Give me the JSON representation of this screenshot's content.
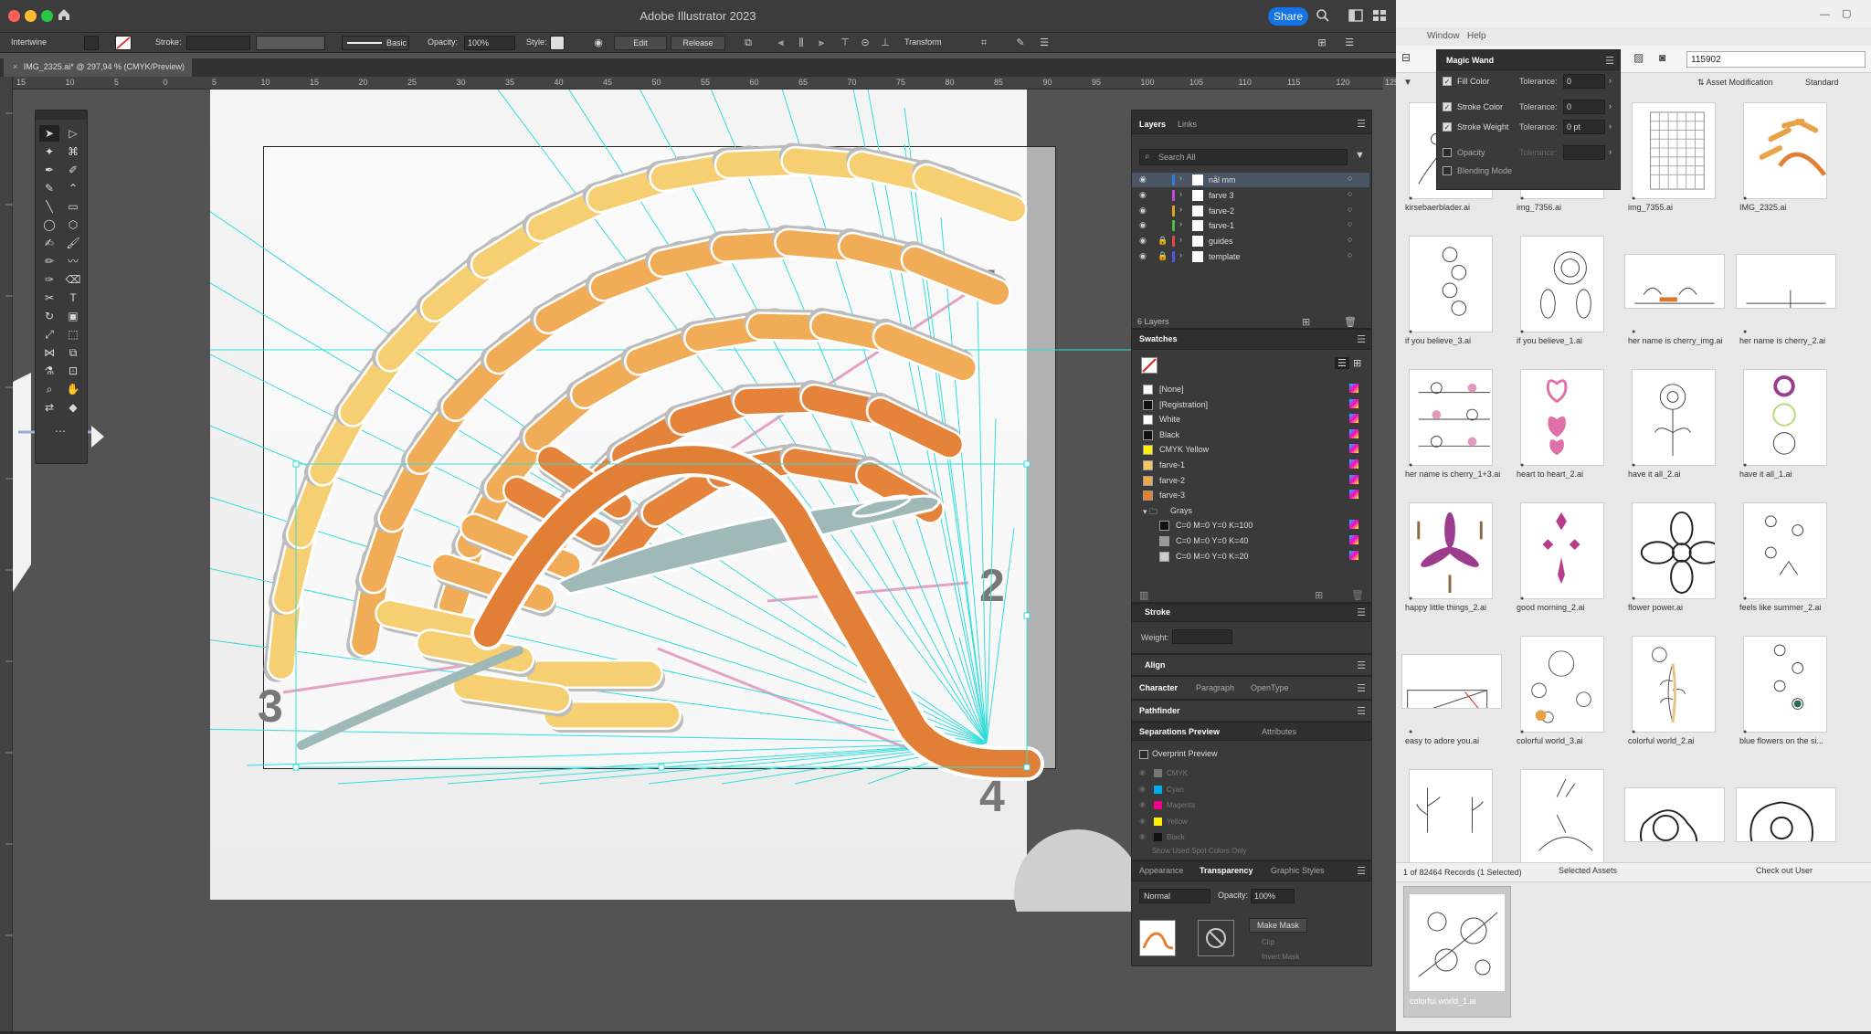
{
  "app": {
    "title": "Adobe Illustrator 2023",
    "share_label": "Share",
    "traffic_colors": [
      "#ff5f57",
      "#febc2e",
      "#28c840"
    ]
  },
  "control": {
    "object_type": "Intertwine",
    "stroke_label": "Stroke:",
    "brush_label": "Basic",
    "opacity_label": "Opacity:",
    "opacity_value": "100%",
    "style_label": "Style:",
    "edit_label": "Edit",
    "release_label": "Release",
    "transform_label": "Transform"
  },
  "document": {
    "tab_label": "IMG_2325.ai* @ 297,94 % (CMYK/Preview)",
    "ruler_ticks": [
      "15",
      "10",
      "5",
      "0",
      "5",
      "10",
      "15",
      "20",
      "25",
      "30",
      "35",
      "40",
      "45",
      "50",
      "55",
      "60",
      "65",
      "70",
      "75",
      "80",
      "85",
      "90",
      "95",
      "100",
      "105",
      "110",
      "115",
      "120",
      "125"
    ]
  },
  "artwork": {
    "numbers": [
      "1",
      "2",
      "3",
      "4"
    ]
  },
  "layers_panel": {
    "tabs": [
      "Layers",
      "Links"
    ],
    "search_placeholder": "Search All",
    "layers": [
      {
        "name": "nål mm",
        "color": "#2f7fd8",
        "locked": false
      },
      {
        "name": "farve 3",
        "color": "#c04bd8",
        "locked": false
      },
      {
        "name": "farve-2",
        "color": "#e0a020",
        "locked": false
      },
      {
        "name": "farve-1",
        "color": "#42c24a",
        "locked": false
      },
      {
        "name": "guides",
        "color": "#e04848",
        "locked": true
      },
      {
        "name": "template",
        "color": "#4a5ae0",
        "locked": true
      }
    ],
    "count": "6 Layers"
  },
  "swatches_panel": {
    "title": "Swatches",
    "items": [
      {
        "name": "[None]",
        "color": "#ffffff"
      },
      {
        "name": "[Registration]",
        "color": "#111111"
      },
      {
        "name": "White",
        "color": "#ffffff"
      },
      {
        "name": "Black",
        "color": "#111111"
      },
      {
        "name": "CMYK Yellow",
        "color": "#fff200"
      },
      {
        "name": "farve-1",
        "color": "#f3c766"
      },
      {
        "name": "farve-2",
        "color": "#eea64e"
      },
      {
        "name": "farve-3",
        "color": "#e67f2e"
      },
      {
        "name": "Grays",
        "color": ""
      },
      {
        "name": "C=0 M=0 Y=0 K=100",
        "color": "#111111"
      },
      {
        "name": "C=0 M=0 Y=0 K=40",
        "color": "#999999"
      },
      {
        "name": "C=0 M=0 Y=0 K=20",
        "color": "#cccccc"
      }
    ]
  },
  "stroke_panel": {
    "title": "Stroke",
    "weight_label": "Weight:"
  },
  "align_panel": {
    "title": "Align"
  },
  "character_panel": {
    "tabs": [
      "Character",
      "Paragraph",
      "OpenType"
    ]
  },
  "pathfinder_panel": {
    "title": "Pathfinder"
  },
  "separations_panel": {
    "tabs": [
      "Separations Preview",
      "Attributes"
    ],
    "overprint_label": "Overprint Preview",
    "plates": [
      "CMYK",
      "Cyan",
      "Magenta",
      "Yellow",
      "Black"
    ],
    "spot_label": "Show Used Spot Colors Only"
  },
  "transparency_panel": {
    "tabs": [
      "Appearance",
      "Transparency",
      "Graphic Styles"
    ],
    "blend_mode": "Normal",
    "opacity_label": "Opacity:",
    "opacity_value": "100%",
    "make_mask_label": "Make Mask",
    "clip_label": "Clip",
    "invert_label": "Invert Mask"
  },
  "magic_wand": {
    "title": "Magic Wand",
    "rows": [
      {
        "label": "Fill Color",
        "checked": true,
        "tolerance": "0"
      },
      {
        "label": "Stroke Color",
        "checked": true,
        "tolerance": "0"
      },
      {
        "label": "Stroke Weight",
        "checked": true,
        "tolerance": "0 pt"
      },
      {
        "label": "Opacity",
        "checked": false,
        "tolerance": ""
      },
      {
        "label": "Blending Mode",
        "checked": false,
        "tolerance": ""
      }
    ],
    "tolerance_label": "Tolerance:"
  },
  "bridge": {
    "menu": [
      "Window",
      "Help"
    ],
    "search_value": "115902",
    "sort_label": "Asset Modification",
    "view_label": "Standard",
    "thumbs": [
      {
        "label": "kirsebaerblader.ai"
      },
      {
        "label": "img_7356.ai"
      },
      {
        "label": "img_7355.ai"
      },
      {
        "label": "IMG_2325.ai"
      },
      {
        "label": "if you believe_3.ai"
      },
      {
        "label": "if you believe_1.ai"
      },
      {
        "label": "her name is cherry_img.ai"
      },
      {
        "label": "her name is cherry_2.ai"
      },
      {
        "label": "her name is cherry_1+3.ai"
      },
      {
        "label": "heart to heart_2.ai"
      },
      {
        "label": "have it all_2.ai"
      },
      {
        "label": "have it all_1.ai"
      },
      {
        "label": "happy little things_2.ai"
      },
      {
        "label": "good morning_2.ai"
      },
      {
        "label": "flower power.ai"
      },
      {
        "label": "feels like summer_2.ai"
      },
      {
        "label": "easy to adore you.ai"
      },
      {
        "label": "colorful world_3.ai"
      },
      {
        "label": "colorful world_2.ai"
      },
      {
        "label": "blue flowers on the si..."
      },
      {
        "label": ""
      },
      {
        "label": ""
      },
      {
        "label": ""
      },
      {
        "label": ""
      }
    ],
    "records_label": "1 of 82464 Records (1 Selected)",
    "selected_assets_label": "Selected Assets",
    "checkout_label": "Check out User",
    "preview_label": "colorful world_1.ai"
  }
}
